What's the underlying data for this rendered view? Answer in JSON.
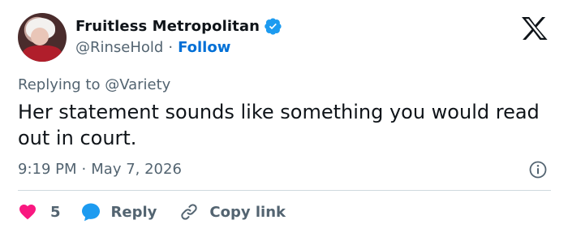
{
  "author": {
    "display_name": "Fruitless Metropolitan",
    "handle": "@RinseHold",
    "separator": "·",
    "follow_label": "Follow",
    "verified": true
  },
  "reply_context": "Replying to @Variety",
  "tweet": {
    "text": "Her statement sounds like something you would read out in court.",
    "time": "9:19 PM",
    "separator": "·",
    "date": "May 7, 2026"
  },
  "actions": {
    "like_count": "5",
    "reply_label": "Reply",
    "copy_link_label": "Copy link"
  },
  "icons": [
    "verified-badge-icon",
    "x-logo-icon",
    "info-icon",
    "heart-icon",
    "reply-bubble-icon",
    "link-icon"
  ],
  "colors": {
    "text_primary": "#0f1419",
    "text_secondary": "#536471",
    "accent_blue": "#006fd6",
    "verified_blue": "#1d9bf0",
    "like_pink": "#f91880",
    "divider": "#cfd9de"
  }
}
